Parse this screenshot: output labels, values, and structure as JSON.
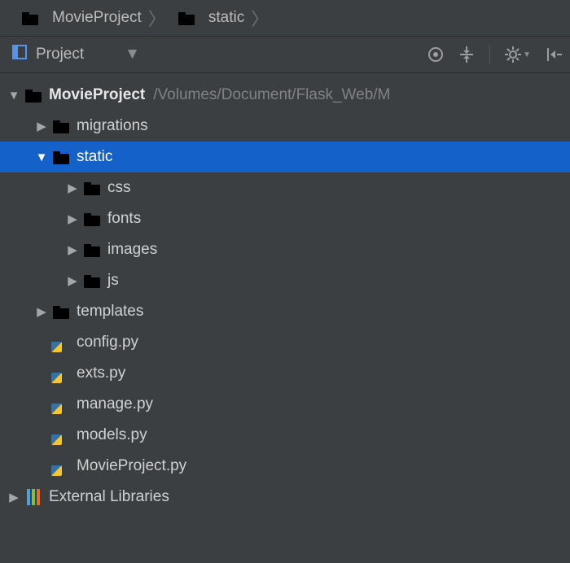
{
  "breadcrumb": [
    {
      "label": "MovieProject",
      "icon": "folder"
    },
    {
      "label": "static",
      "icon": "folder"
    }
  ],
  "viewSelector": {
    "label": "Project"
  },
  "tree": {
    "root": {
      "label": "MovieProject",
      "path": "/Volumes/Document/Flask_Web/M"
    },
    "children": {
      "migrations": "migrations",
      "static": "static",
      "static_children": {
        "css": "css",
        "fonts": "fonts",
        "images": "images",
        "js": "js"
      },
      "templates": "templates",
      "files": {
        "config": "config.py",
        "exts": "exts.py",
        "manage": "manage.py",
        "models": "models.py",
        "movieproject": "MovieProject.py"
      }
    },
    "external": "External Libraries"
  }
}
